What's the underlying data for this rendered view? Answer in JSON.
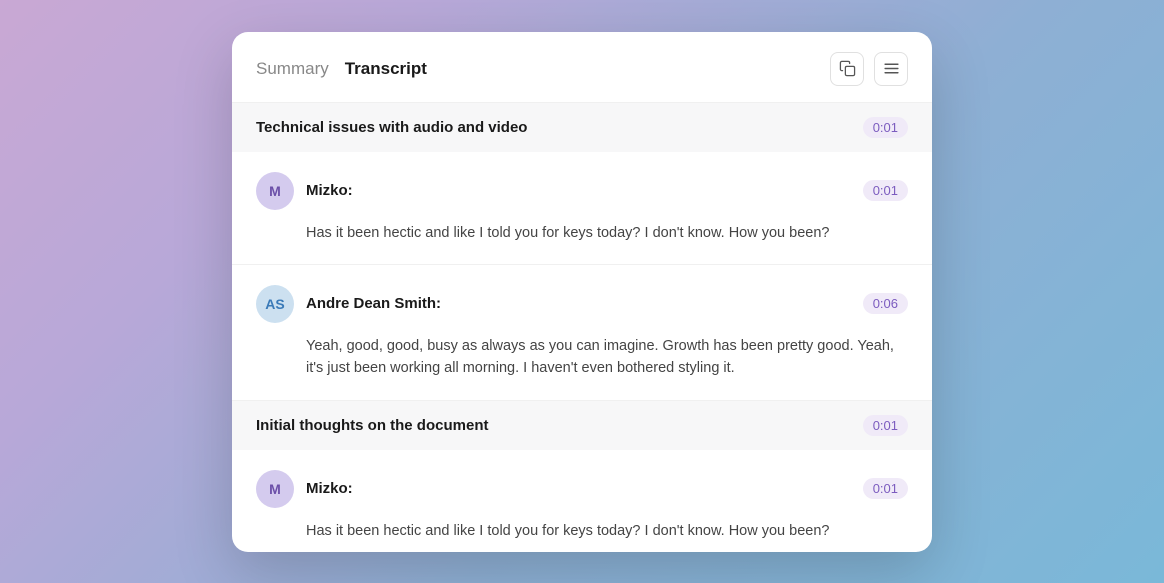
{
  "header": {
    "summary_tab": "Summary",
    "transcript_tab": "Transcript",
    "copy_icon": "copy-icon",
    "menu_icon": "menu-icon"
  },
  "sections": [
    {
      "id": "section-1",
      "title": "Technical issues with audio and video",
      "timestamp": "0:01",
      "messages": [
        {
          "id": "msg-1",
          "avatar_initials": "M",
          "avatar_class": "m",
          "author": "Mizko:",
          "timestamp": "0:01",
          "text": "Has it been hectic and like I told you for keys today? I don't know. How you been?"
        },
        {
          "id": "msg-2",
          "avatar_initials": "AS",
          "avatar_class": "as",
          "author": "Andre Dean Smith:",
          "timestamp": "0:06",
          "text": "Yeah, good, good, busy as always as you can imagine. Growth has been pretty good. Yeah, it's just been working all morning. I haven't even bothered styling it."
        }
      ]
    },
    {
      "id": "section-2",
      "title": "Initial thoughts on the document",
      "timestamp": "0:01",
      "messages": [
        {
          "id": "msg-3",
          "avatar_initials": "M",
          "avatar_class": "m",
          "author": "Mizko:",
          "timestamp": "0:01",
          "text": "Has it been hectic and like I told you for keys today? I don't know. How you been?"
        }
      ]
    }
  ]
}
